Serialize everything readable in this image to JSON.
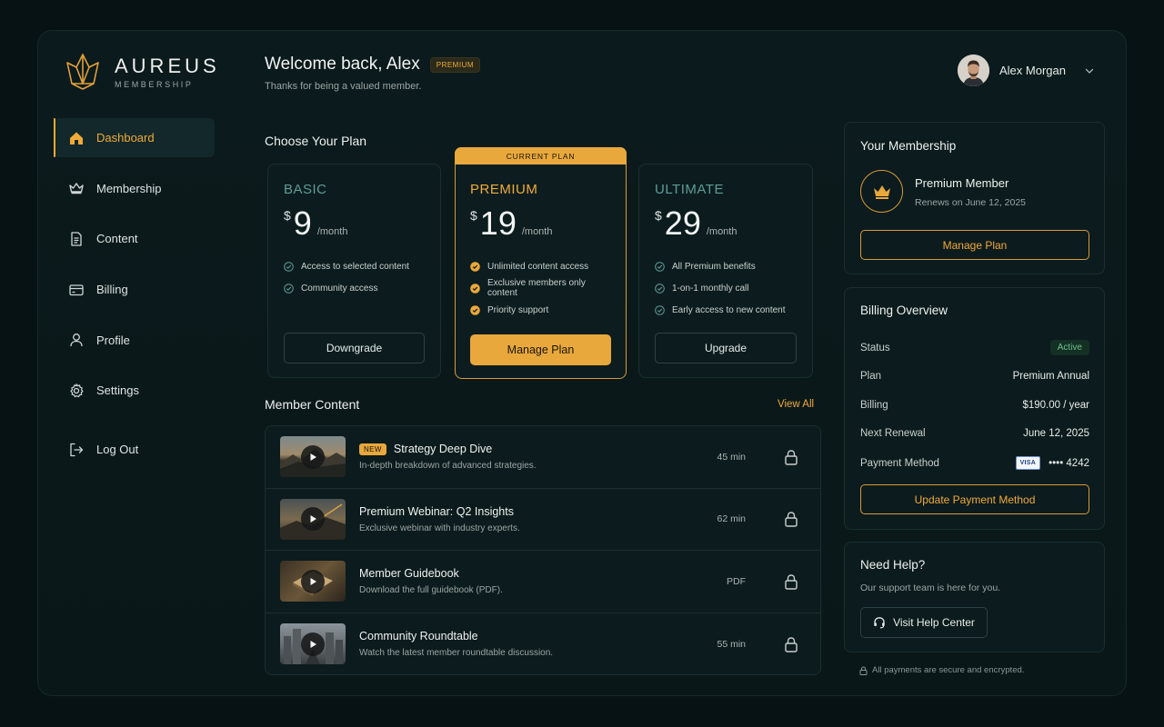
{
  "brand": {
    "title": "AUREUS",
    "subtitle": "MEMBERSHIP"
  },
  "nav": [
    {
      "label": "Dashboard",
      "icon": "home-icon",
      "active": true
    },
    {
      "label": "Membership",
      "icon": "crown-icon"
    },
    {
      "label": "Content",
      "icon": "document-icon"
    },
    {
      "label": "Billing",
      "icon": "credit-card-icon"
    },
    {
      "label": "Profile",
      "icon": "user-icon"
    },
    {
      "label": "Settings",
      "icon": "gear-icon"
    },
    {
      "label": "Log Out",
      "icon": "logout-icon"
    }
  ],
  "header": {
    "welcome": "Welcome back, Alex",
    "badge": "PREMIUM",
    "subtitle": "Thanks for being a valued member.",
    "user_name": "Alex Morgan"
  },
  "plans_section": {
    "title": "Choose Your Plan"
  },
  "plans": [
    {
      "name": "BASIC",
      "currency": "$",
      "price": "9",
      "period": "/month",
      "features": [
        "Access to selected content",
        "Community access"
      ],
      "button": "Downgrade"
    },
    {
      "name": "PREMIUM",
      "currency": "$",
      "price": "19",
      "period": "/month",
      "tag": "CURRENT PLAN",
      "features": [
        "Unlimited content access",
        "Exclusive members only content",
        "Priority support"
      ],
      "button": "Manage Plan"
    },
    {
      "name": "ULTIMATE",
      "currency": "$",
      "price": "29",
      "period": "/month",
      "features": [
        "All Premium benefits",
        "1-on-1 monthly call",
        "Early access to new content"
      ],
      "button": "Upgrade"
    }
  ],
  "content_section": {
    "title": "Member Content",
    "view_all": "View All"
  },
  "content": [
    {
      "badge": "NEW",
      "title": "Strategy Deep Dive",
      "subtitle": "In-depth breakdown of advanced strategies.",
      "meta": "45 min"
    },
    {
      "title": "Premium Webinar: Q2 Insights",
      "subtitle": "Exclusive webinar with industry experts.",
      "meta": "62 min"
    },
    {
      "title": "Member Guidebook",
      "subtitle": "Download the full guidebook (PDF).",
      "meta": "PDF"
    },
    {
      "title": "Community Roundtable",
      "subtitle": "Watch the latest member roundtable discussion.",
      "meta": "55 min"
    }
  ],
  "membership_card": {
    "title": "Your Membership",
    "name": "Premium Member",
    "renews": "Renews on June 12, 2025",
    "button": "Manage Plan"
  },
  "billing": {
    "title": "Billing Overview",
    "status_label": "Status",
    "status_value": "Active",
    "plan_label": "Plan",
    "plan_value": "Premium Annual",
    "billing_label": "Billing",
    "billing_value": "$190.00 / year",
    "renewal_label": "Next Renewal",
    "renewal_value": "June 12, 2025",
    "payment_label": "Payment Method",
    "card_brand": "VISA",
    "card_value": "•••• 4242",
    "button": "Update Payment Method"
  },
  "help": {
    "title": "Need Help?",
    "subtitle": "Our support team is here for you.",
    "button": "Visit Help Center"
  },
  "footer": {
    "secure": "All payments are secure and encrypted."
  },
  "colors": {
    "accent": "#f0aa38",
    "background": "#061214",
    "teal_text": "#5e9c96",
    "active_green": "#6cc08c"
  }
}
